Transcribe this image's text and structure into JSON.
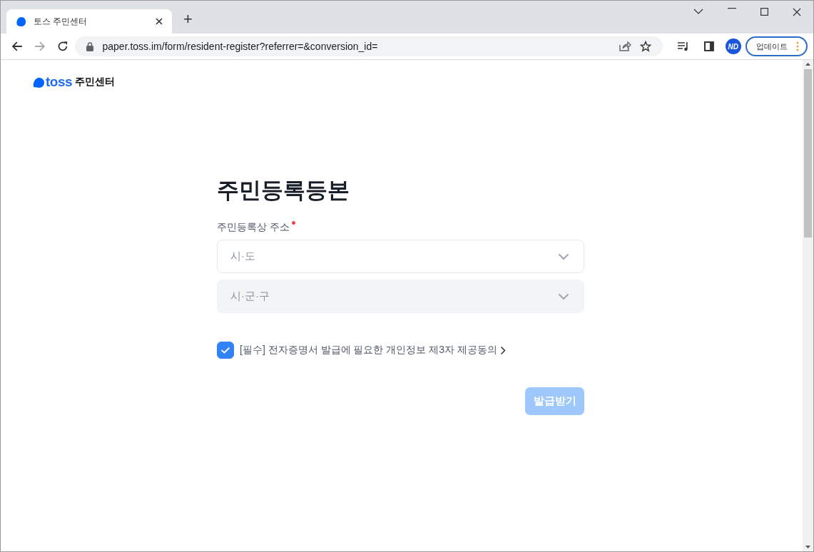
{
  "browser": {
    "tabs": [
      {
        "title": "토스 주민센터",
        "selected": true
      }
    ],
    "new_tab": "+",
    "url": "paper.toss.im/form/resident-register?referrer=&conversion_id=",
    "profile": "ND",
    "update_button": "업데이트"
  },
  "page": {
    "logo": {
      "wordmark": "toss",
      "suffix": "주민센터"
    },
    "title": "주민등록등본",
    "field": {
      "label": "주민등록상 주소",
      "required": true,
      "selects": [
        {
          "placeholder": "시·도",
          "disabled": false
        },
        {
          "placeholder": "시·군·구",
          "disabled": true
        }
      ]
    },
    "consent": {
      "text": "[필수] 전자증명서 발급에 필요한 개인정보 제3자 제공동의",
      "checked": true
    },
    "submit": {
      "label": "발급받기",
      "disabled": true
    }
  }
}
